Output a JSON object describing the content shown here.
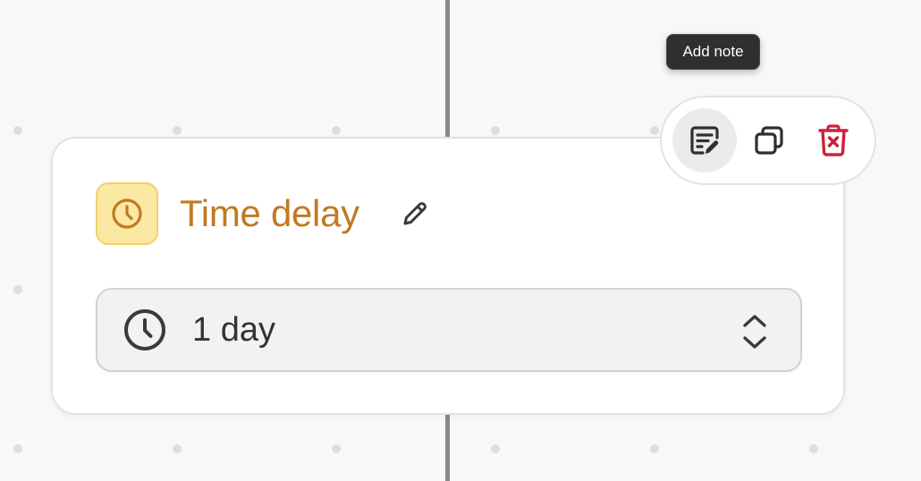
{
  "node": {
    "title": "Time delay",
    "icon": "clock-icon",
    "accent_color": "#c27a20",
    "icon_bg_color": "#fbe8a2"
  },
  "duration": {
    "value": "1 day",
    "icon": "clock-icon"
  },
  "toolbar": {
    "actions": [
      {
        "name": "add-note",
        "icon": "note-edit-icon",
        "active": true
      },
      {
        "name": "duplicate",
        "icon": "copy-icon",
        "active": false
      },
      {
        "name": "delete",
        "icon": "trash-icon",
        "color": "#c8233b",
        "active": false
      }
    ]
  },
  "tooltip": {
    "text": "Add note"
  }
}
